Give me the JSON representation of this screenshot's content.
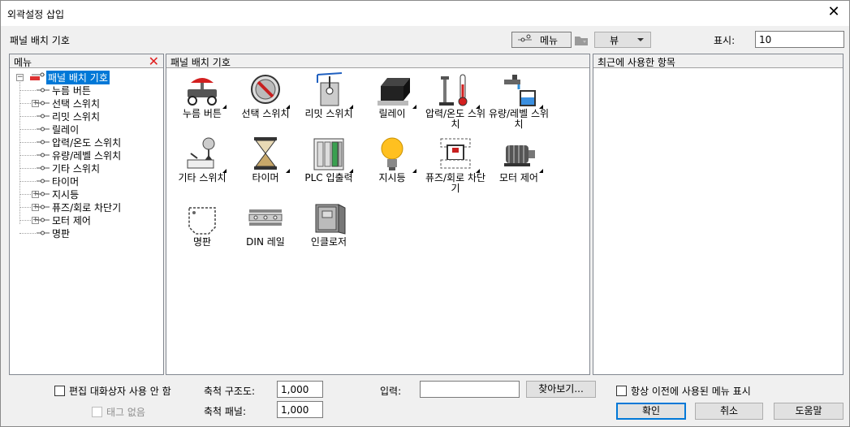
{
  "window": {
    "title": "외곽설정 삽입",
    "close_glyph": "✕"
  },
  "toolbar": {
    "label": "패널 배치 기호",
    "menu_button": "메뉴",
    "view_button": "뷰",
    "display_label": "표시:",
    "display_value": "10"
  },
  "left_panel": {
    "header": "메뉴",
    "tree": [
      {
        "label": "패널 배치 기호",
        "level": 0,
        "expander": "−",
        "selected": true
      },
      {
        "label": "누름 버튼",
        "level": 1,
        "expander": ""
      },
      {
        "label": "선택 스위치",
        "level": 1,
        "expander": "+"
      },
      {
        "label": "리밋 스위치",
        "level": 1,
        "expander": ""
      },
      {
        "label": "릴레이",
        "level": 1,
        "expander": ""
      },
      {
        "label": "압력/온도 스위치",
        "level": 1,
        "expander": ""
      },
      {
        "label": "유량/레벨 스위치",
        "level": 1,
        "expander": ""
      },
      {
        "label": "기타 스위치",
        "level": 1,
        "expander": ""
      },
      {
        "label": "타이머",
        "level": 1,
        "expander": ""
      },
      {
        "label": "지시등",
        "level": 1,
        "expander": "+"
      },
      {
        "label": "퓨즈/회로 차단기",
        "level": 1,
        "expander": "+"
      },
      {
        "label": "모터 제어",
        "level": 1,
        "expander": "+"
      },
      {
        "label": "명판",
        "level": 1,
        "expander": ""
      }
    ]
  },
  "middle_panel": {
    "header": "패널 배치 기호",
    "items": [
      {
        "label": "누름 버튼",
        "icon": "push-button-icon"
      },
      {
        "label": "선택 스위치",
        "icon": "selector-switch-icon"
      },
      {
        "label": "리밋 스위치",
        "icon": "limit-switch-icon"
      },
      {
        "label": "릴레이",
        "icon": "relay-icon"
      },
      {
        "label": "압력/온도 스위치",
        "icon": "pressure-temp-switch-icon"
      },
      {
        "label": "유량/레벨 스위치",
        "icon": "flow-level-switch-icon"
      },
      {
        "label": "기타 스위치",
        "icon": "other-switch-icon"
      },
      {
        "label": "타이머",
        "icon": "timer-icon"
      },
      {
        "label": "PLC 입출력",
        "icon": "plc-io-icon"
      },
      {
        "label": "지시등",
        "icon": "pilot-light-icon"
      },
      {
        "label": "퓨즈/회로 차단기",
        "icon": "fuse-breaker-icon"
      },
      {
        "label": "모터 제어",
        "icon": "motor-control-icon"
      },
      {
        "label": "명판",
        "icon": "nameplate-icon"
      },
      {
        "label": "DIN 레일",
        "icon": "din-rail-icon"
      },
      {
        "label": "인클로저",
        "icon": "enclosure-icon"
      }
    ]
  },
  "right_panel": {
    "header": "최근에 사용한 항목"
  },
  "bottom": {
    "edit_dialog_checkbox": "편집 대화상자 사용 안 함",
    "no_tag_checkbox": "태그 없음",
    "scale_drawing_label": "축척 구조도:",
    "scale_drawing_value": "1,000",
    "scale_panel_label": "축척 패널:",
    "scale_panel_value": "1,000",
    "input_label": "입력:",
    "input_value": "",
    "browse_button": "찾아보기...",
    "always_show_checkbox": "항상 이전에 사용된 메뉴 표시",
    "ok_button": "확인",
    "cancel_button": "취소",
    "help_button": "도움말"
  },
  "colors": {
    "selection": "#0078d7",
    "close_x": "#e02020"
  }
}
